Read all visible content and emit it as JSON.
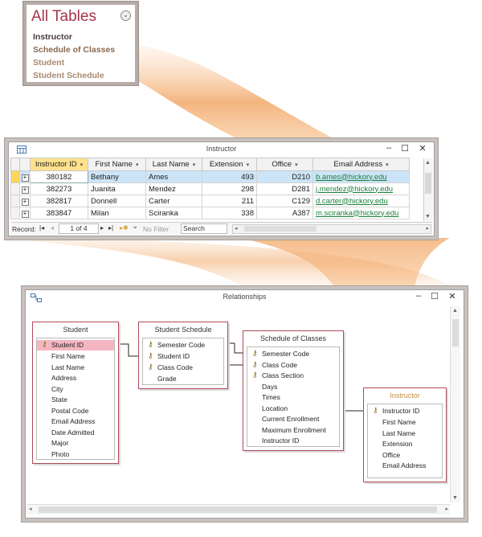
{
  "nav_pane": {
    "title": "All Tables",
    "items": [
      {
        "label": "Instructor",
        "color": "#4a3a3a"
      },
      {
        "label": "Schedule of Classes",
        "color": "#8a6a50"
      },
      {
        "label": "Student",
        "color": "#a88a70"
      },
      {
        "label": "Student Schedule",
        "color": "#a88a70"
      }
    ],
    "colors": {
      "title": "#a3334a",
      "frame": "#b7aca8"
    }
  },
  "datasheet": {
    "title": "Instructor",
    "controls": {
      "minimize": "–",
      "maximize": "☐",
      "close": "✕"
    },
    "columns": [
      "Instructor ID",
      "First Name",
      "Last Name",
      "Extension",
      "Office",
      "Email Address"
    ],
    "rows": [
      {
        "id": "380182",
        "first": "Bethany",
        "last": "Ames",
        "ext": "493",
        "office": "D210",
        "email": "b.ames@hickory.edu"
      },
      {
        "id": "382273",
        "first": "Juanita",
        "last": "Mendez",
        "ext": "298",
        "office": "D281",
        "email": "j.mendez@hickory.edu"
      },
      {
        "id": "382817",
        "first": "Donnell",
        "last": "Carter",
        "ext": "211",
        "office": "C129",
        "email": "d.carter@hickory.edu"
      },
      {
        "id": "383847",
        "first": "Milan",
        "last": "Sciranka",
        "ext": "338",
        "office": "A387",
        "email": "m.sciranka@hickory.edu"
      }
    ],
    "record_nav": {
      "label": "Record:",
      "position": "1 of 4",
      "filter": "No Filter",
      "search": "Search"
    },
    "colors": {
      "selected_header": "#ffe28c",
      "selected_row": "#cce4f7",
      "email_link": "#1a7f3a"
    }
  },
  "relationships": {
    "title": "Relationships",
    "controls": {
      "minimize": "–",
      "maximize": "☐",
      "close": "✕"
    },
    "tables": [
      {
        "name": "Student",
        "fields": [
          {
            "label": "Student ID",
            "key": true,
            "selected": true
          },
          {
            "label": "First Name"
          },
          {
            "label": "Last Name"
          },
          {
            "label": "Address"
          },
          {
            "label": "City"
          },
          {
            "label": "State"
          },
          {
            "label": "Postal Code"
          },
          {
            "label": "Email Address"
          },
          {
            "label": "Date Admitted"
          },
          {
            "label": "Major"
          },
          {
            "label": "Photo"
          }
        ]
      },
      {
        "name": "Student Schedule",
        "fields": [
          {
            "label": "Semester Code",
            "key": true
          },
          {
            "label": "Student ID",
            "key": true
          },
          {
            "label": "Class Code",
            "key": true
          },
          {
            "label": "Grade"
          }
        ]
      },
      {
        "name": "Schedule of Classes",
        "fields": [
          {
            "label": "Semester Code",
            "key": true
          },
          {
            "label": "Class Code",
            "key": true
          },
          {
            "label": "Class Section",
            "key": true
          },
          {
            "label": "Days"
          },
          {
            "label": "Times"
          },
          {
            "label": "Location"
          },
          {
            "label": "Current Enrollment"
          },
          {
            "label": "Maximum Enrollment"
          },
          {
            "label": "Instructor ID"
          }
        ]
      },
      {
        "name": "Instructor",
        "fields": [
          {
            "label": "Instructor ID",
            "key": true
          },
          {
            "label": "First Name"
          },
          {
            "label": "Last Name"
          },
          {
            "label": "Extension"
          },
          {
            "label": "Office"
          },
          {
            "label": "Email Address"
          }
        ]
      }
    ],
    "colors": {
      "table_border": "#b04a5a",
      "selected_field": "#f4b6c0"
    }
  },
  "icons": {
    "key": "key-icon",
    "datasheet": "table-icon",
    "relationships": "relationships-icon"
  },
  "beam_color": "#f0a060"
}
